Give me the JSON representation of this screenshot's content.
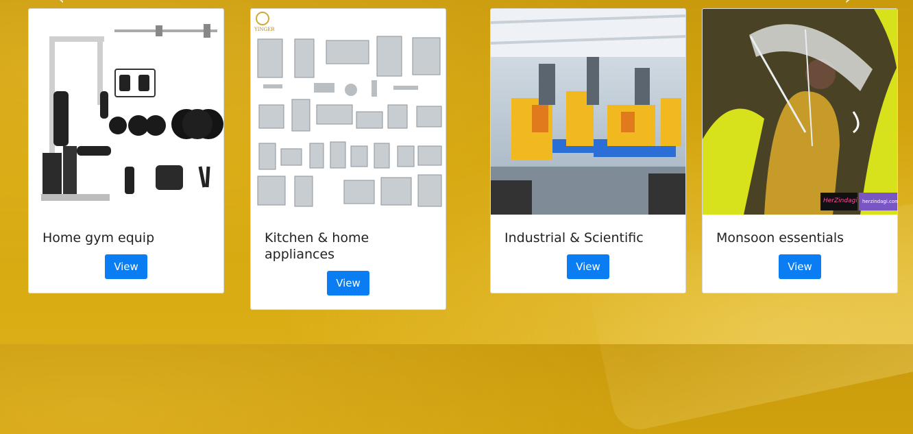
{
  "carousel": {
    "prev_icon": "chevron-left-icon",
    "next_icon": "chevron-right-icon"
  },
  "cards": [
    {
      "title": "Home gym equip",
      "button": "View",
      "image": "home-gym-equipment-photo"
    },
    {
      "title": "Kitchen & home appliances",
      "button": "View",
      "image": "kitchen-appliances-collage",
      "brand": "YINGER"
    },
    {
      "title": "Industrial & Scientific",
      "button": "View",
      "image": "factory-machinery-photo"
    },
    {
      "title": "Monsoon essentials",
      "button": "View",
      "image": "woman-with-umbrella-photo",
      "watermark_brand": "HerZindagi",
      "watermark_site": "herzindagi.com"
    }
  ],
  "colors": {
    "background": "#d3a40f",
    "button": "#0b7df2",
    "card": "#ffffff"
  }
}
